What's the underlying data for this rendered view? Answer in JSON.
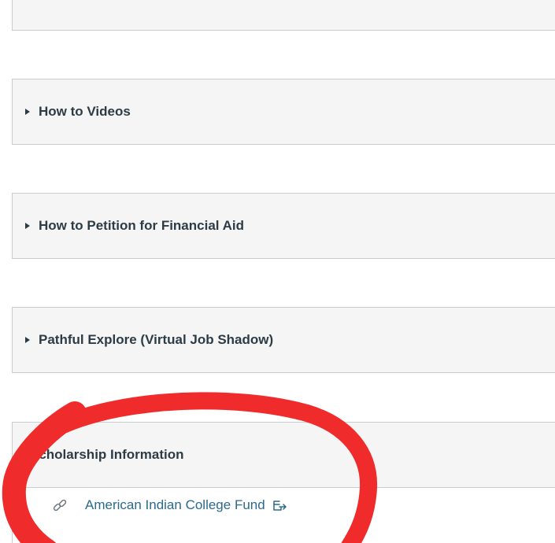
{
  "sections": [
    {
      "title": "How to Videos"
    },
    {
      "title": "How to Petition for Financial Aid"
    },
    {
      "title": "Pathful Explore (Virtual Job Shadow)"
    }
  ],
  "scholarship": {
    "title": "Scholarship Information",
    "link_label": "American Indian College Fund"
  },
  "colors": {
    "panel_bg": "#f5f5f5",
    "border": "#c7cdd1",
    "text": "#2d3b45",
    "link": "#2b6a8c",
    "annotation": "#ef2b2b"
  },
  "icons": {
    "link": "link-icon",
    "external": "external-link-icon",
    "toggle": "triangle-right-icon"
  }
}
